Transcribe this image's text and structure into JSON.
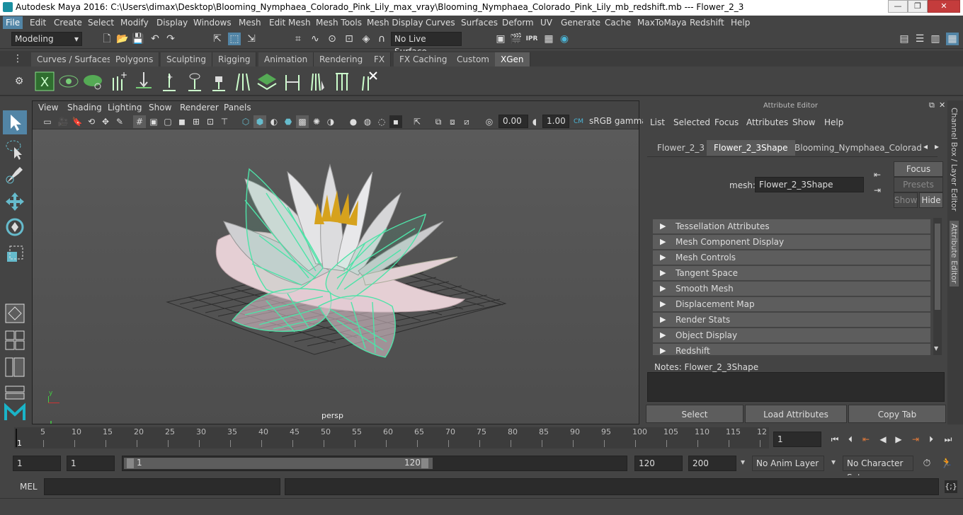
{
  "window": {
    "title": "Autodesk Maya 2016: C:\\Users\\dimax\\Desktop\\Blooming_Nymphaea_Colorado_Pink_Lily_max_vray\\Blooming_Nymphaea_Colorado_Pink_Lily_mb_redshift.mb   ---   Flower_2_3",
    "minimize": "—",
    "restore": "❐",
    "close": "✕"
  },
  "menubar": [
    "File",
    "Edit",
    "Create",
    "Select",
    "Modify",
    "Display",
    "Windows",
    "Mesh",
    "Edit Mesh",
    "Mesh Tools",
    "Mesh Display",
    "Curves",
    "Surfaces",
    "Deform",
    "UV",
    "Generate",
    "Cache",
    "MaxToMaya",
    "Redshift",
    "Help"
  ],
  "status": {
    "mode": "Modeling",
    "live_surface": "No Live Surface"
  },
  "shelf_tabs": [
    "Curves / Surfaces",
    "Polygons",
    "Sculpting",
    "Rigging",
    "Animation",
    "Rendering",
    "FX",
    "FX Caching",
    "Custom",
    "XGen"
  ],
  "viewport": {
    "menu": [
      "View",
      "Shading",
      "Lighting",
      "Show",
      "Renderer",
      "Panels"
    ],
    "exposure": "0.00",
    "gamma": "1.00",
    "color_space": "sRGB gamma",
    "camera_label": "persp"
  },
  "attribute_editor": {
    "header": "Attribute Editor",
    "menu": [
      "List",
      "Selected",
      "Focus",
      "Attributes",
      "Show",
      "Help"
    ],
    "tabs": [
      "Flower_2_3",
      "Flower_2_3Shape",
      "Blooming_Nymphaea_Colorado_Pi"
    ],
    "mesh_label": "mesh:",
    "mesh_value": "Flower_2_3Shape",
    "focus_btn": "Focus",
    "presets_btn": "Presets",
    "show_btn": "Show",
    "hide_btn": "Hide",
    "sections": [
      "Tessellation Attributes",
      "Mesh Component Display",
      "Mesh Controls",
      "Tangent Space",
      "Smooth Mesh",
      "Displacement Map",
      "Render Stats",
      "Object Display",
      "Redshift"
    ],
    "notes_label": "Notes:  Flower_2_3Shape",
    "buttons": {
      "select": "Select",
      "load": "Load Attributes",
      "copy": "Copy Tab"
    }
  },
  "side_panel": {
    "channel_box": "Channel Box / Layer Editor",
    "attr_editor": "Attribute Editor"
  },
  "timeline": {
    "ticks": [
      "5",
      "10",
      "15",
      "20",
      "25",
      "30",
      "35",
      "40",
      "45",
      "50",
      "55",
      "60",
      "65",
      "70",
      "75",
      "80",
      "85",
      "90",
      "95",
      "100",
      "105",
      "110",
      "115",
      "12"
    ],
    "start_marker": "1",
    "current_frame": "1"
  },
  "range": {
    "start": "1",
    "playback_start": "1",
    "slider_start": "1",
    "slider_end": "120",
    "playback_end": "120",
    "end": "200",
    "anim_layer": "No Anim Layer",
    "character_set": "No Character Set"
  },
  "cmdline": {
    "label": "MEL"
  }
}
